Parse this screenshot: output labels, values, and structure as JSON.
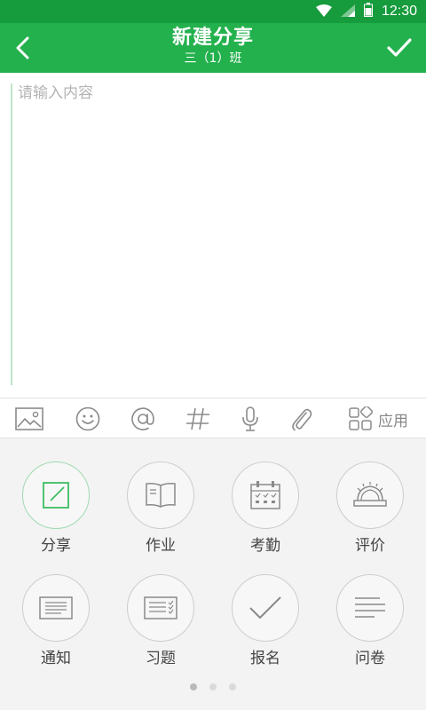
{
  "status_bar": {
    "time": "12:30"
  },
  "header": {
    "title": "新建分享",
    "subtitle": "三（1）班"
  },
  "editor": {
    "placeholder": "请输入内容",
    "value": ""
  },
  "toolbar": {
    "tools": [
      "image-icon",
      "emoji-icon",
      "at-icon",
      "hashtag-icon",
      "microphone-icon",
      "paperclip-icon"
    ],
    "app_label": "应用"
  },
  "grid": {
    "items": [
      {
        "label": "分享",
        "icon": "edit-icon",
        "active": true
      },
      {
        "label": "作业",
        "icon": "book-icon",
        "active": false
      },
      {
        "label": "考勤",
        "icon": "calendar-icon",
        "active": false
      },
      {
        "label": "评价",
        "icon": "badge-icon",
        "active": false
      },
      {
        "label": "通知",
        "icon": "notice-icon",
        "active": false
      },
      {
        "label": "习题",
        "icon": "checklist-icon",
        "active": false
      },
      {
        "label": "报名",
        "icon": "check-icon",
        "active": false
      },
      {
        "label": "问卷",
        "icon": "lines-icon",
        "active": false
      }
    ]
  },
  "pager": {
    "pages": 3,
    "current": 1
  },
  "colors": {
    "status_bar": "#169b3d",
    "app_bar": "#23b14d",
    "accent": "#23b14d",
    "panel_bg": "#f3f3f3"
  }
}
